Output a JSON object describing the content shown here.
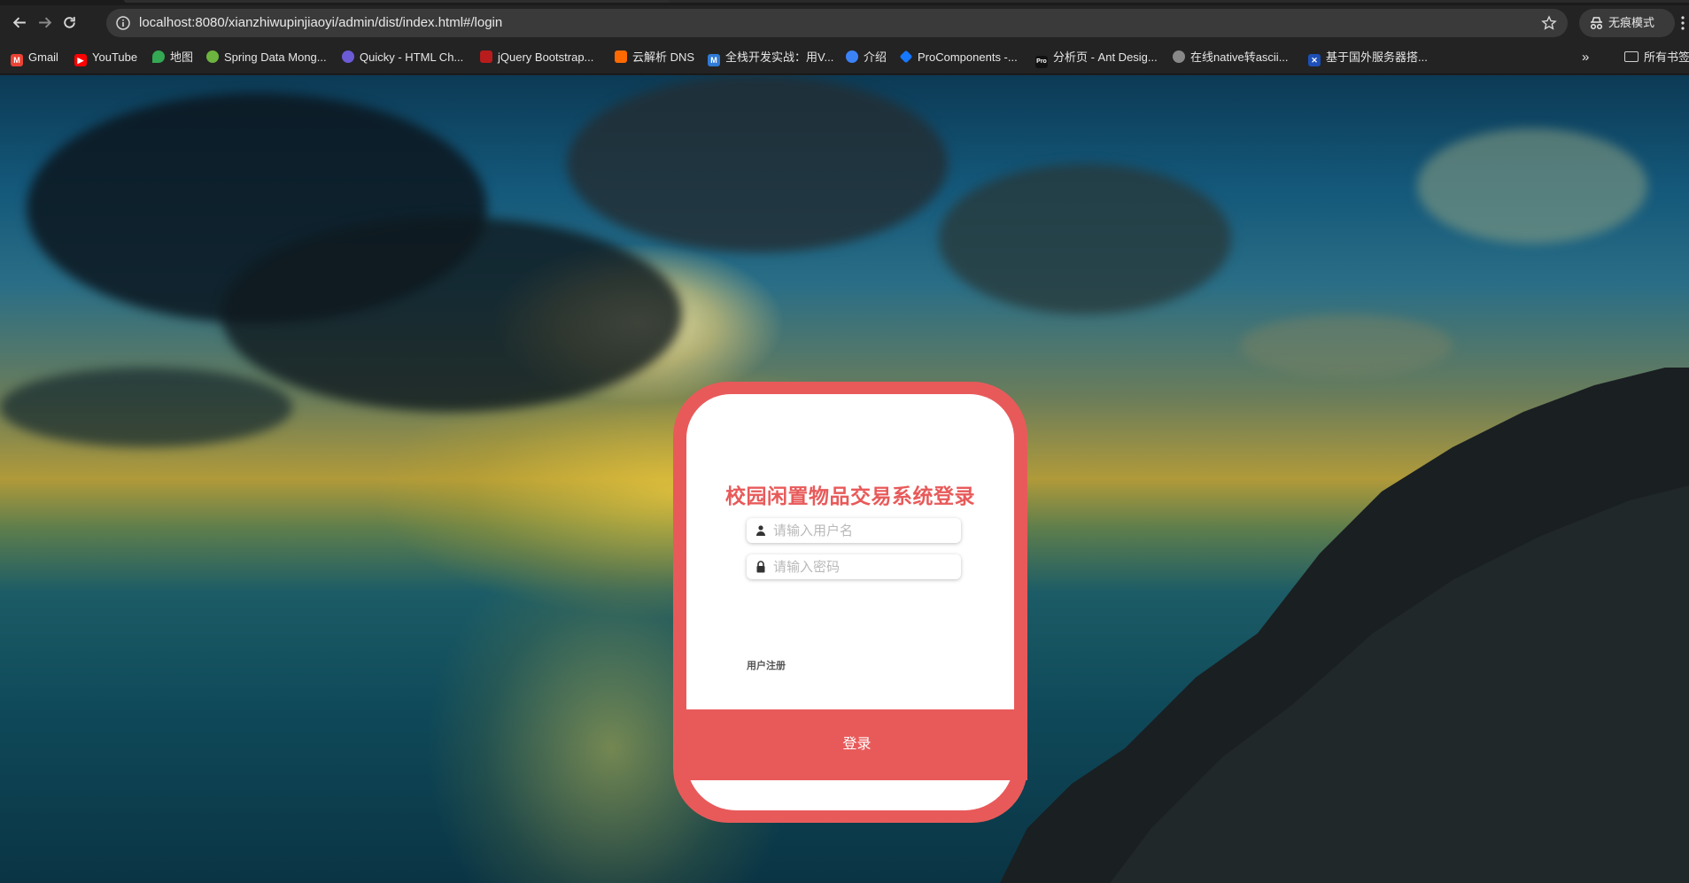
{
  "browser": {
    "url": "localhost:8080/xianzhiwupinjiaoyi/admin/dist/index.html#/login",
    "incognito_label": "无痕模式",
    "bookmarks": [
      {
        "label": "Gmail",
        "icon": "gmail-icon",
        "color": "#ea4335"
      },
      {
        "label": "YouTube",
        "icon": "youtube-icon",
        "color": "#ff0000"
      },
      {
        "label": "地图",
        "icon": "maps-icon",
        "color": "#34a853"
      },
      {
        "label": "Spring Data Mong...",
        "icon": "spring-icon",
        "color": "#6db33f"
      },
      {
        "label": "Quicky - HTML Ch...",
        "icon": "quicky-icon",
        "color": "#6b5bd6"
      },
      {
        "label": "jQuery Bootstrap...",
        "icon": "jquery-icon",
        "color": "#b81c1c"
      },
      {
        "label": "云解析 DNS",
        "icon": "dns-icon",
        "color": "#ff6a00"
      },
      {
        "label": "全栈开发实战：用V...",
        "icon": "m-icon",
        "color": "#2f7ad6"
      },
      {
        "label": "介绍",
        "icon": "intro-icon",
        "color": "#3b82f6"
      },
      {
        "label": "ProComponents -...",
        "icon": "procomponents-icon",
        "color": "#1677ff"
      },
      {
        "label": "分析页 - Ant Desig...",
        "icon": "pro-icon",
        "color": "#111111"
      },
      {
        "label": "在线native转ascii...",
        "icon": "globe-icon",
        "color": "#888888"
      },
      {
        "label": "基于国外服务器搭...",
        "icon": "flag-icon",
        "color": "#1d4fb8"
      }
    ],
    "more_label": "»",
    "all_bookmarks_label": "所有书签"
  },
  "login": {
    "title": "校园闲置物品交易系统登录",
    "username_placeholder": "请输入用户名",
    "password_placeholder": "请输入密码",
    "register_label": "用户注册",
    "login_button_label": "登录",
    "accent_color": "#e85a5a"
  }
}
